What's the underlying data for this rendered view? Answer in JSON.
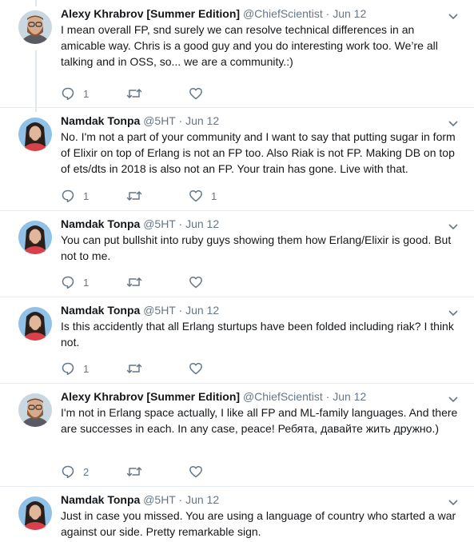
{
  "tweets": [
    {
      "name": "Alexy Khrabrov [Summer Edition]",
      "handle": "@ChiefScientist",
      "separator": "·",
      "date": "Jun 12",
      "text": "I mean overall FP, snd surely we can resolve technical differences in an amicable way. Chris is a good guy and you do interesting work too.  We’re all talking and in OSS, so... we are a community.:)",
      "replies": "1",
      "retweets": "",
      "likes": ""
    },
    {
      "name": "Namdak Tonpa",
      "handle": "@5HT",
      "separator": "·",
      "date": "Jun 12",
      "text": "No. I'm not a part of your community and I want to say that putting sugar in form of Elixir on top of Erlang is not an FP too. Also Riak is not FP. Making DB on top of ets/dts in 2018 is also not an FP. Your train has gone. Live with that.",
      "replies": "1",
      "retweets": "",
      "likes": "1"
    },
    {
      "name": "Namdak Tonpa",
      "handle": "@5HT",
      "separator": "·",
      "date": "Jun 12",
      "text": "You can put bullshit into ruby guys showing them how Erlang/Elixir is good. But not to me.",
      "replies": "1",
      "retweets": "",
      "likes": ""
    },
    {
      "name": "Namdak Tonpa",
      "handle": "@5HT",
      "separator": "·",
      "date": "Jun 12",
      "text": "Is this accidently that all Erlang sturtups have been folded including riak? I think not.",
      "replies": "1",
      "retweets": "",
      "likes": ""
    },
    {
      "name": "Alexy Khrabrov [Summer Edition]",
      "handle": "@ChiefScientist",
      "separator": "·",
      "date": "Jun 12",
      "text": "I'm not in Erlang space actually, I like all FP and ML-family languages.  And there are successes in each.  In any case, peace!  Ребята, давайте жить дружно.)",
      "replies": "2",
      "retweets": "",
      "likes": ""
    },
    {
      "name": "Namdak Tonpa",
      "handle": "@5HT",
      "separator": "·",
      "date": "Jun 12",
      "text": "Just in case you missed. You are using a language of country who started a war against our side. Pretty remarkable sign.",
      "replies": "",
      "retweets": "",
      "likes": ""
    }
  ],
  "icons": {
    "reply": "reply-icon",
    "retweet": "retweet-icon",
    "like": "heart-icon",
    "menu": "chevron-down-icon"
  },
  "colors": {
    "text": "#14171a",
    "muted": "#657786",
    "thread_line": "#e1e8ed",
    "divider": "#e6ecf0"
  }
}
